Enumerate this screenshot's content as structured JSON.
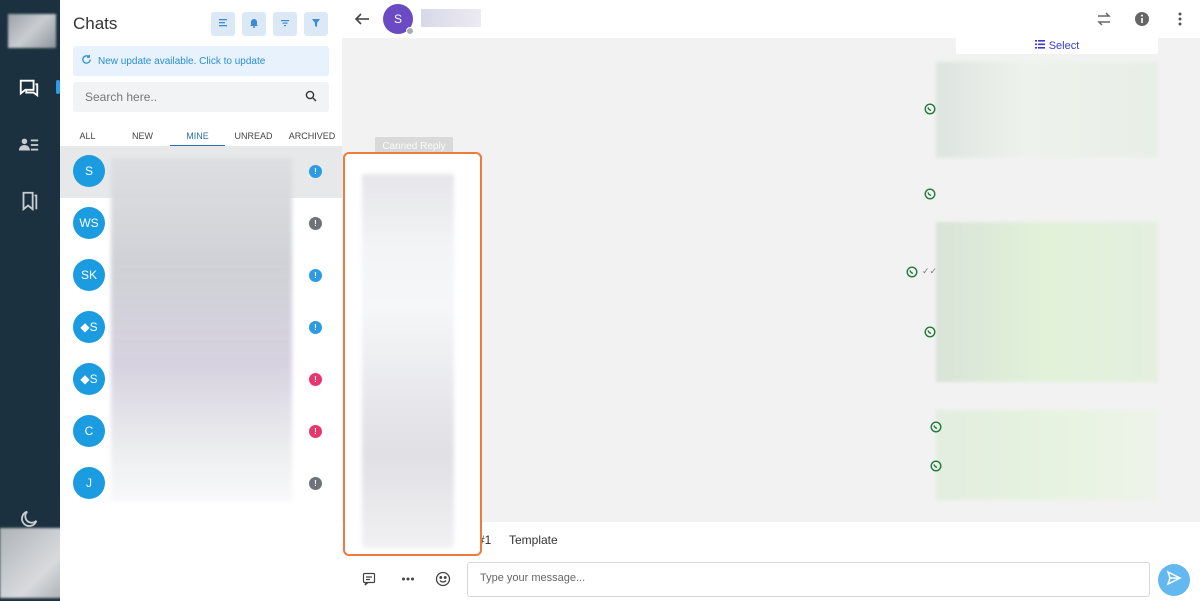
{
  "chats_panel": {
    "title": "Chats",
    "update_banner": "New update available. Click to update",
    "search_placeholder": "Search here..",
    "tabs": [
      {
        "label": "ALL"
      },
      {
        "label": "NEW"
      },
      {
        "label": "MINE",
        "active": true
      },
      {
        "label": "UNREAD"
      },
      {
        "label": "ARCHIVED"
      }
    ],
    "chats": [
      {
        "initials": "S",
        "badge": "!",
        "badge_color": "#2b9be5",
        "selected": true
      },
      {
        "initials": "WS",
        "badge": "!",
        "badge_color": "#6e7379"
      },
      {
        "initials": "SK",
        "badge": "!",
        "badge_color": "#2b9be5"
      },
      {
        "initials": "◆S",
        "badge": "!",
        "badge_color": "#2b9be5"
      },
      {
        "initials": "◆S",
        "badge": "!",
        "badge_color": "#e8356e"
      },
      {
        "initials": "C",
        "badge": "!",
        "badge_color": "#e8356e"
      },
      {
        "initials": "J",
        "badge": "!",
        "badge_color": "#6e7379"
      }
    ]
  },
  "conversation": {
    "contact_initial": "S",
    "select_label": "Select",
    "canned_reply_label": "Canned Reply",
    "template_number": "#1",
    "template_label": "Template",
    "message_placeholder": "Type your message..."
  },
  "icons": {
    "rail": [
      "chat-icon",
      "contacts-icon",
      "bookmarks-icon",
      "moon-icon"
    ],
    "toolbar": [
      "list-icon",
      "bell-icon",
      "sort-icon",
      "filter-icon"
    ],
    "topbar": [
      "back-arrow-icon",
      "transfer-icon",
      "info-icon",
      "more-vertical-icon"
    ],
    "compose": [
      "note-icon",
      "ellipsis-icon",
      "emoji-icon",
      "send-icon"
    ],
    "message": "whatsapp-icon"
  },
  "colors": {
    "rail_bg": "#1c3140",
    "accent": "#2b9be5",
    "contact_avatar": "#6a4bc4",
    "canned_highlight": "#f07a3c",
    "send_button": "#64b8f0"
  }
}
